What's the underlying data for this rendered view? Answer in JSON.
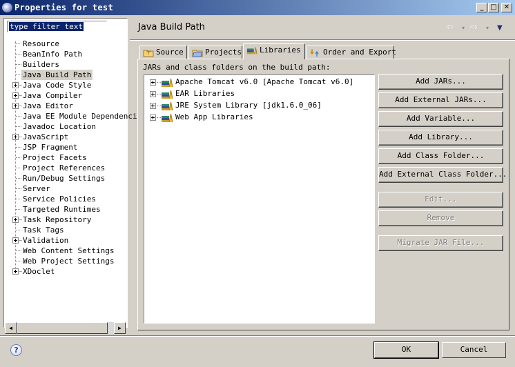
{
  "window": {
    "title": "Properties for test",
    "controls": [
      "minimize",
      "maximize",
      "close"
    ]
  },
  "filter": {
    "value": "type filter text"
  },
  "sidebar": {
    "items": [
      {
        "label": "Resource",
        "expandable": false
      },
      {
        "label": "BeanInfo Path",
        "expandable": false
      },
      {
        "label": "Builders",
        "expandable": false
      },
      {
        "label": "Java Build Path",
        "expandable": false,
        "selected": true
      },
      {
        "label": "Java Code Style",
        "expandable": true
      },
      {
        "label": "Java Compiler",
        "expandable": true
      },
      {
        "label": "Java Editor",
        "expandable": true
      },
      {
        "label": "Java EE Module Dependenci",
        "expandable": false
      },
      {
        "label": "Javadoc Location",
        "expandable": false
      },
      {
        "label": "JavaScript",
        "expandable": true
      },
      {
        "label": "JSP Fragment",
        "expandable": false
      },
      {
        "label": "Project Facets",
        "expandable": false
      },
      {
        "label": "Project References",
        "expandable": false
      },
      {
        "label": "Run/Debug Settings",
        "expandable": false
      },
      {
        "label": "Server",
        "expandable": false
      },
      {
        "label": "Service Policies",
        "expandable": false
      },
      {
        "label": "Targeted Runtimes",
        "expandable": false
      },
      {
        "label": "Task Repository",
        "expandable": true
      },
      {
        "label": "Task Tags",
        "expandable": false
      },
      {
        "label": "Validation",
        "expandable": true
      },
      {
        "label": "Web Content Settings",
        "expandable": false
      },
      {
        "label": "Web Project Settings",
        "expandable": false
      },
      {
        "label": "XDoclet",
        "expandable": true
      }
    ]
  },
  "header": {
    "title": "Java Build Path",
    "nav": {
      "back": "⇦",
      "forward": "⇨",
      "menu": "▼",
      "dropdown": "▾"
    }
  },
  "tabs": [
    {
      "label": "Source",
      "icon": "source-folder-icon"
    },
    {
      "label": "Projects",
      "icon": "project-folder-icon"
    },
    {
      "label": "Libraries",
      "icon": "library-icon",
      "active": true
    },
    {
      "label": "Order and Export",
      "icon": "order-export-icon"
    }
  ],
  "libraries": {
    "section_label": "JARs and class folders on the build path:",
    "items": [
      "Apache Tomcat v6.0 [Apache Tomcat v6.0]",
      "EAR Libraries",
      "JRE System Library [jdk1.6.0_06]",
      "Web App Libraries"
    ]
  },
  "buttons": {
    "add_jars": "Add JARs...",
    "add_external_jars": "Add External JARs...",
    "add_variable": "Add Variable...",
    "add_library": "Add Library...",
    "add_class_folder": "Add Class Folder...",
    "add_external_class_folder": "Add External Class Folder...",
    "edit": "Edit...",
    "remove": "Remove",
    "migrate_jar": "Migrate JAR File..."
  },
  "footer": {
    "help": "?",
    "ok": "OK",
    "cancel": "Cancel"
  }
}
